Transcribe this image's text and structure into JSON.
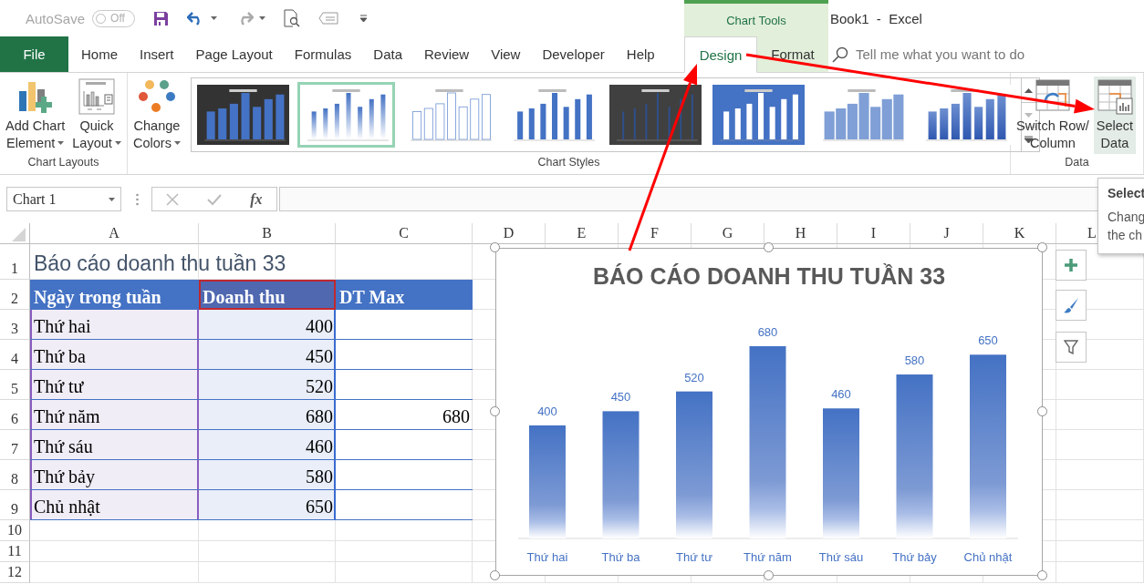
{
  "quick_access": {
    "autosave_label": "AutoSave",
    "autosave_toggle": {
      "label": "Off",
      "on": false
    }
  },
  "context_tab_group": "Chart Tools",
  "title": "Book1  -  Excel",
  "tabs": [
    {
      "label": "File",
      "kind": "file",
      "selected": false
    },
    {
      "label": "Home",
      "kind": "normal",
      "selected": false
    },
    {
      "label": "Insert",
      "kind": "normal",
      "selected": false
    },
    {
      "label": "Page Layout",
      "kind": "normal",
      "selected": false
    },
    {
      "label": "Formulas",
      "kind": "normal",
      "selected": false
    },
    {
      "label": "Data",
      "kind": "normal",
      "selected": false
    },
    {
      "label": "Review",
      "kind": "normal",
      "selected": false
    },
    {
      "label": "View",
      "kind": "normal",
      "selected": false
    },
    {
      "label": "Developer",
      "kind": "normal",
      "selected": false
    },
    {
      "label": "Help",
      "kind": "normal",
      "selected": false
    },
    {
      "label": "Design",
      "kind": "context",
      "selected": true
    },
    {
      "label": "Format",
      "kind": "context",
      "selected": false
    }
  ],
  "search": {
    "placeholder": "Tell me what you want to do"
  },
  "ribbon": {
    "groups": [
      {
        "label": "Chart Layouts",
        "buttons": [
          {
            "lines": [
              "Add Chart",
              "Element"
            ],
            "dropdown": true,
            "highlighted": false
          },
          {
            "lines": [
              "Quick",
              "Layout"
            ],
            "dropdown": true,
            "highlighted": false
          }
        ]
      },
      {
        "label": "Chart Styles",
        "buttons": [
          {
            "lines": [
              "Change",
              "Colors"
            ],
            "dropdown": true,
            "highlighted": false
          }
        ],
        "gallery": [
          {
            "kind": "dark",
            "selected": false
          },
          {
            "kind": "gradient",
            "selected": true
          },
          {
            "kind": "outline",
            "selected": false
          },
          {
            "kind": "light",
            "selected": false
          },
          {
            "kind": "dark-flat",
            "selected": false
          },
          {
            "kind": "pattern",
            "selected": false
          },
          {
            "kind": "pale",
            "selected": false
          },
          {
            "kind": "deep",
            "selected": false
          }
        ]
      },
      {
        "label": "Data",
        "buttons": [
          {
            "lines": [
              "Switch Row/",
              "Column"
            ],
            "dropdown": false,
            "highlighted": false
          },
          {
            "lines": [
              "Select",
              "Data"
            ],
            "dropdown": false,
            "highlighted": true
          }
        ]
      }
    ]
  },
  "tooltip": {
    "title": "Select",
    "lines": [
      "Chang",
      "the ch"
    ]
  },
  "formula_bar": {
    "name_box": "Chart 1",
    "function_label": "fx"
  },
  "sheet": {
    "columns": [
      "A",
      "B",
      "C",
      "D",
      "E",
      "F",
      "G",
      "H",
      "I",
      "J",
      "K",
      "L"
    ],
    "rows": [
      {
        "number": "1",
        "kind": "title",
        "cells": [
          "Báo cáo doanh thu tuần 33"
        ]
      },
      {
        "number": "2",
        "kind": "header",
        "cells": [
          "Ngày trong tuần",
          "Doanh thu",
          "DT Max"
        ]
      },
      {
        "number": "3",
        "kind": "data",
        "cells": [
          "Thứ hai",
          "400"
        ]
      },
      {
        "number": "4",
        "kind": "data",
        "cells": [
          "Thứ ba",
          "450"
        ]
      },
      {
        "number": "5",
        "kind": "data",
        "cells": [
          "Thứ tư",
          "520"
        ]
      },
      {
        "number": "6",
        "kind": "data",
        "cells": [
          "Thứ năm",
          "680",
          "680"
        ]
      },
      {
        "number": "7",
        "kind": "data",
        "cells": [
          "Thứ sáu",
          "460"
        ]
      },
      {
        "number": "8",
        "kind": "data",
        "cells": [
          "Thứ bảy",
          "580"
        ]
      },
      {
        "number": "9",
        "kind": "data",
        "cells": [
          "Chủ nhật",
          "650"
        ]
      },
      {
        "number": "10",
        "kind": "empty",
        "cells": []
      },
      {
        "number": "11",
        "kind": "empty",
        "cells": []
      },
      {
        "number": "12",
        "kind": "empty",
        "cells": []
      }
    ]
  },
  "chart": {
    "chart_data": {
      "type": "bar",
      "title": "BÁO CÁO DOANH THU TUẦN 33",
      "categories": [
        "Thứ hai",
        "Thứ ba",
        "Thứ tư",
        "Thứ năm",
        "Thứ sáu",
        "Thứ bảy",
        "Chủ nhật"
      ],
      "values": [
        400,
        450,
        520,
        680,
        460,
        580,
        650
      ],
      "data_labels": true
    }
  }
}
